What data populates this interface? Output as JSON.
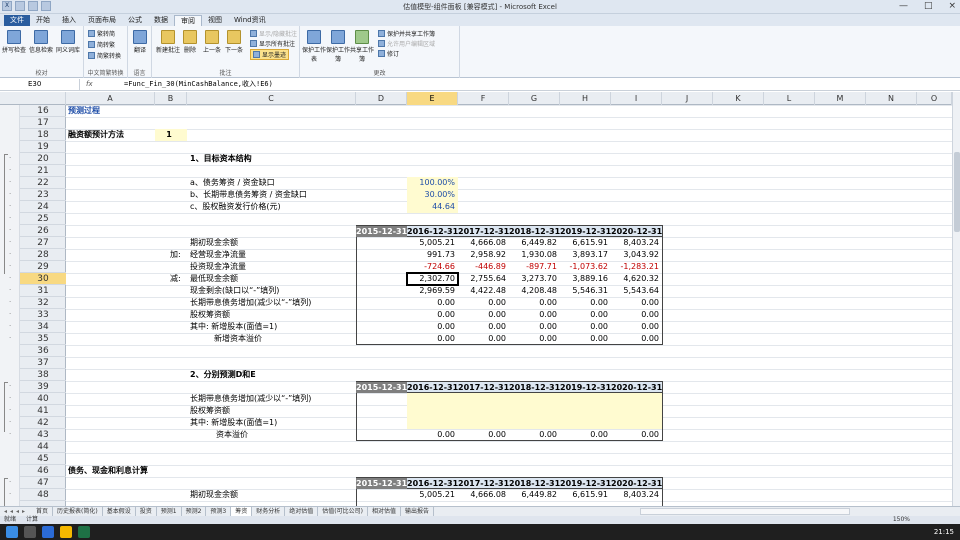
{
  "window": {
    "title": "估值模型-组件面板 [兼容模式] - Microsoft Excel",
    "controls": [
      "—",
      "□",
      "×"
    ]
  },
  "ribbon_tabs": [
    "文件",
    "开始",
    "插入",
    "页面布局",
    "公式",
    "数据",
    "审阅",
    "视图",
    "Wind资讯"
  ],
  "active_tab": "审阅",
  "ribbon": {
    "groups": [
      "校对",
      "中文简繁转换",
      "语言",
      "批注",
      "更改"
    ],
    "proof_buttons": [
      "拼写检查",
      "信息检索",
      "同义词库"
    ],
    "convert": [
      "繁转简",
      "简转繁",
      "简繁转换"
    ],
    "lang_button": "翻译",
    "comment_buttons": [
      "新建批注",
      "删除",
      "上一条",
      "下一条"
    ],
    "comment_small": [
      "显示/隐藏批注",
      "显示所有批注",
      "显示墨迹"
    ],
    "change_buttons": [
      "保护工作表",
      "保护工作簿",
      "共享工作簿"
    ],
    "change_small": [
      "保护并共享工作簿",
      "允许用户编辑区域",
      "修订"
    ]
  },
  "formula_bar": {
    "name_box": "E30",
    "fx": "fx",
    "formula": "=Func_Fin_30(MinCashBalance,收入!E6)"
  },
  "columns": [
    "A",
    "B",
    "C",
    "D",
    "E",
    "F",
    "G",
    "H",
    "I",
    "J",
    "K",
    "L",
    "M",
    "N",
    "O"
  ],
  "rows": [
    "16",
    "17",
    "18",
    "19",
    "20",
    "21",
    "22",
    "23",
    "24",
    "25",
    "26",
    "27",
    "28",
    "29",
    "30",
    "31",
    "32",
    "33",
    "34",
    "35",
    "36",
    "37",
    "38",
    "39",
    "40",
    "41",
    "42",
    "43",
    "44",
    "45",
    "46",
    "47",
    "48"
  ],
  "cells": {
    "r16": "预测过程",
    "r18_label": "融资额预计方法",
    "r18_value": "1",
    "r20": "1、目标资本结构",
    "r22": "a、债务筹资 / 资金缺口",
    "r22_v": "100.00%",
    "r23": "b、长期带息债务筹资 / 资金缺口",
    "r23_v": "30.00%",
    "r24": "c、股权融资发行价格(元)",
    "r24_v": "44.64",
    "r37": "2、分别预测D和E",
    "r46": "债务、现金和利息计算"
  },
  "table1": {
    "years": [
      "2015-12-31",
      "2016-12-31",
      "2017-12-31",
      "2018-12-31",
      "2019-12-31",
      "2020-12-31"
    ],
    "rows": [
      {
        "prefix": "",
        "label": "期初现金余额",
        "values": [
          "5,005.21",
          "4,666.08",
          "6,449.82",
          "6,615.91",
          "8,403.24"
        ]
      },
      {
        "prefix": "加:",
        "label": "经营现金净流量",
        "values": [
          "991.73",
          "2,958.92",
          "1,930.08",
          "3,893.17",
          "3,043.92"
        ]
      },
      {
        "prefix": "",
        "label": "投资现金净流量",
        "values": [
          "-724.66",
          "-446.89",
          "-897.71",
          "-1,073.62",
          "-1,283.21"
        ]
      },
      {
        "prefix": "减:",
        "label": "最低现金余额",
        "values": [
          "2,302.70",
          "2,755.64",
          "3,273.70",
          "3,889.16",
          "4,620.32"
        ]
      },
      {
        "prefix": "",
        "label": "现金剩余(缺口以“-”填列)",
        "values": [
          "2,969.59",
          "4,422.48",
          "4,208.48",
          "5,546.31",
          "5,543.64"
        ]
      },
      {
        "prefix": "",
        "label": "长期带息债务增加(减少以“-”填列)",
        "values": [
          "0.00",
          "0.00",
          "0.00",
          "0.00",
          "0.00"
        ]
      },
      {
        "prefix": "",
        "label": "股权筹资额",
        "values": [
          "0.00",
          "0.00",
          "0.00",
          "0.00",
          "0.00"
        ]
      },
      {
        "prefix": "",
        "label": "其中: 新增股本(面值=1)",
        "values": [
          "0.00",
          "0.00",
          "0.00",
          "0.00",
          "0.00"
        ]
      },
      {
        "prefix": "",
        "label": "新增资本溢价",
        "values": [
          "0.00",
          "0.00",
          "0.00",
          "0.00",
          "0.00"
        ]
      }
    ]
  },
  "table2": {
    "years": [
      "2015-12-31",
      "2016-12-31",
      "2017-12-31",
      "2018-12-31",
      "2019-12-31",
      "2020-12-31"
    ],
    "rows": [
      {
        "label": "长期带息债务增加(减少以“-”填列)",
        "values": [
          "",
          "",
          "",
          "",
          ""
        ]
      },
      {
        "label": "股权筹资额",
        "values": [
          "",
          "",
          "",
          "",
          ""
        ]
      },
      {
        "label": "其中: 新增股本(面值=1)",
        "values": [
          "",
          "",
          "",
          "",
          ""
        ]
      },
      {
        "label": "资本溢价",
        "values": [
          "0.00",
          "0.00",
          "0.00",
          "0.00",
          "0.00"
        ]
      }
    ]
  },
  "table3": {
    "years": [
      "2015-12-31",
      "2016-12-31",
      "2017-12-31",
      "2018-12-31",
      "2019-12-31",
      "2020-12-31"
    ],
    "rows": [
      {
        "label": "期初现金余额",
        "values": [
          "5,005.21",
          "4,666.08",
          "6,449.82",
          "6,615.91",
          "8,403.24"
        ]
      }
    ]
  },
  "sheet_tabs": [
    "首页",
    "历史报表(简化)",
    "基本假设",
    "投资",
    "预测1",
    "预测2",
    "预测3",
    "筹资",
    "财务分析",
    "绝对估值",
    "估值(可比公司)",
    "相对估值",
    "输出报告"
  ],
  "active_sheet": "筹资",
  "status": {
    "left": "就绪",
    "right": "计算",
    "zoom": "150%"
  },
  "taskbar": {
    "time": "21:15"
  }
}
